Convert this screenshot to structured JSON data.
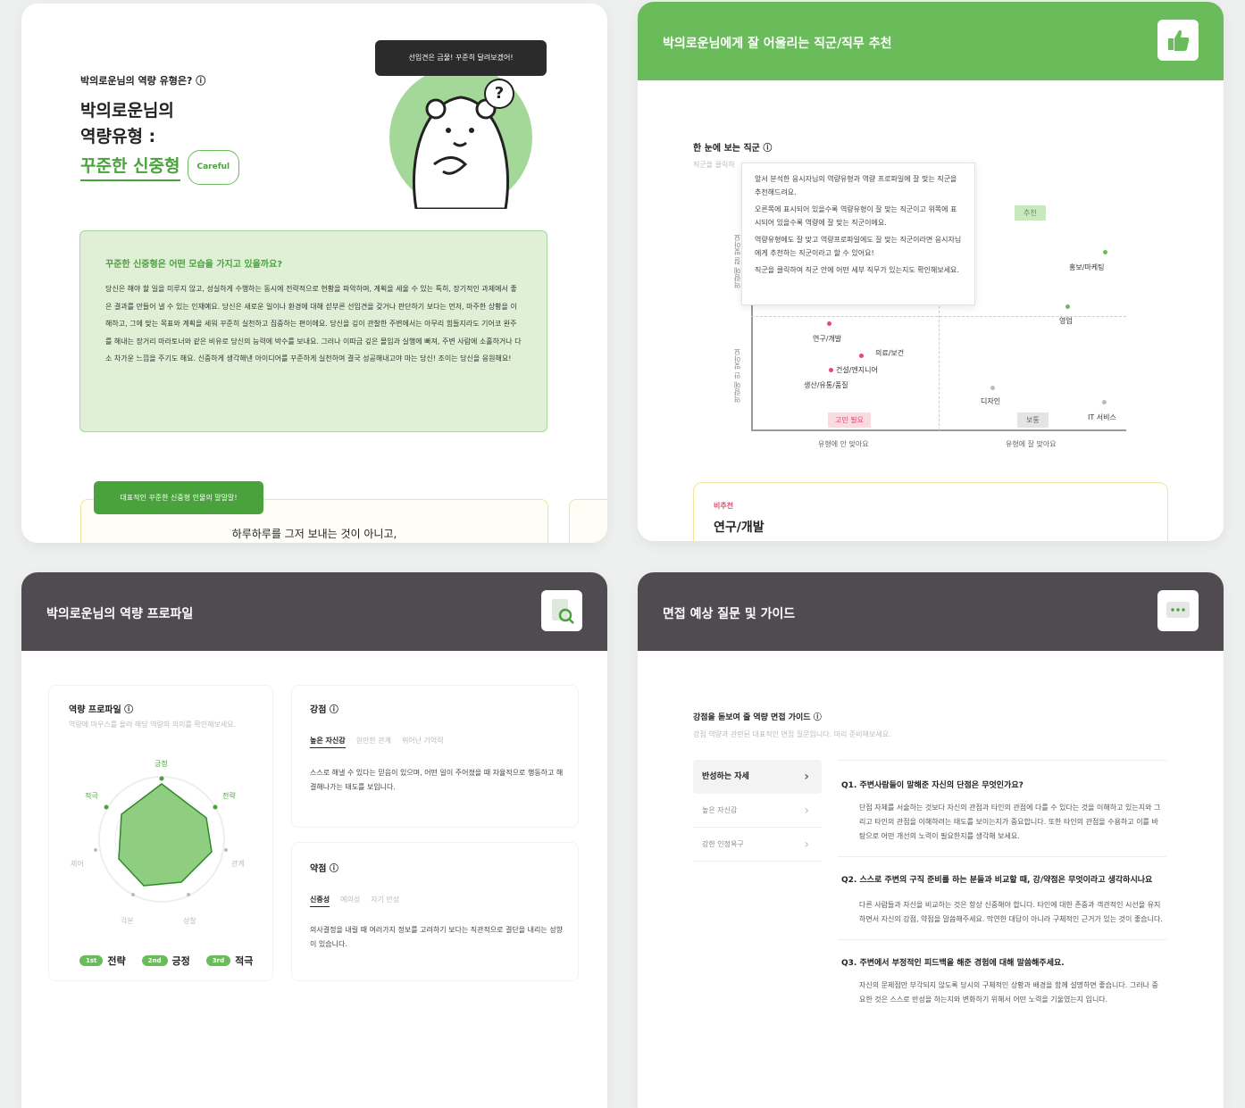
{
  "colors": {
    "accent": "#6abb5a",
    "dark_header": "#4f4b50",
    "red_dot": "#e8476a"
  },
  "p1": {
    "question": "박의로운님의 역량 유형은? ⓘ",
    "title_line1": "박의로운님의",
    "title_line2": "역량유형 :",
    "type_name": "꾸준한 신중형",
    "type_pill": "Careful",
    "speech": "선입견은 금물! 꾸준히 달려보겠어!",
    "box_title": "꾸준한 신중형은 어떤 모습을 가지고 있을까요?",
    "box_body": "당신은 해야 할 일을 미루지 않고, 성실하게 수행하는 동시에 전략적으로 현황을 파악하며, 계획을 세울 수 있는 특히, 장기적인 과제에서 좋은 결과를 만들어 낼 수 있는 인재예요. 당신은 새로운 일이나 환경에 대해 섣부른 선입견을 갖거나 판단하기 보다는 먼저, 마주한 상황을 이해하고, 그에 맞는 목표와 계획을 세워 꾸준히 실천하고 집중하는 편이에요. 당신을 깊이 관찰한 주변에서는 아무리 힘들지라도 기어코 완주를 해내는 장거리 마라토너와 같은 비유로 당신의 능력에 박수를 보내요. 그러나 이따금 깊은 몰입과 실행에 빠져, 주변 사람에 소홀하거나 다소 차가운 느낌을 주기도 해요. 신중하게 생각해낸 아이디어를 꾸준하게 실천하여 결국 성공해내고야 마는 당신! 조이는 당신을 응원해요!",
    "quote_tag": "대표적인 꾸준한 신중형 인물의 말말말!",
    "quote_text": "하루하루를 그저 보내는 것이 아니고,"
  },
  "p2": {
    "header_title": "박의로운님에게 잘 어울리는 직군/직무 추천",
    "section_title": "한 눈에 보는 직군 ⓘ",
    "section_sub": "직군을 클릭하",
    "tooltip": [
      "앞서 분석한 응시자님의 역량유형과 역량 프로파일에 잘 맞는 직군을 추천해드려요.",
      "오른쪽에 표시되어 있을수록 역량유형이 잘 맞는 직군이고 위쪽에 표시되어 있을수록 역량에 잘 맞는 직군이에요.",
      "역량유형에도 잘 맞고 역량프로파일에도 잘 맞는 직군이라면 응시자님에게 추천하는 직군이라고 할 수 있어요!",
      "직군을 클릭하여 직군 안에 어떤 세부 직무가 있는지도 확인해보세요."
    ],
    "chart": {
      "recommend_tag": "추천",
      "caution_tag": "고민 필요",
      "normal_tag": "보통",
      "y_axis_top": "역량에 잘 맞아요",
      "y_axis_bottom": "역량에 안 맞아요",
      "x_left": "유형에 안 맞아요",
      "x_right": "유형에 잘 맞아요",
      "jobs": [
        "홍보/마케팅",
        "영업",
        "연구/개발",
        "의료/보건",
        "건설/엔지니어",
        "생산/유통/품질",
        "디자인",
        "IT 서비스"
      ]
    },
    "card_label": "비추천",
    "card_title": "연구/개발"
  },
  "p3": {
    "header_title": "박의로운님의 역량 프로파일",
    "profile_title": "역량 프로파일 ⓘ",
    "profile_sub": "역량에 마우스를 올려 해당 역량의 의미를 확인해보세요.",
    "radar_labels": [
      "긍정",
      "전략",
      "관계",
      "성찰",
      "각본",
      "제어",
      "적극"
    ],
    "ranks": [
      {
        "badge": "1st",
        "label": "전략"
      },
      {
        "badge": "2nd",
        "label": "긍정"
      },
      {
        "badge": "3rd",
        "label": "적극"
      }
    ],
    "strength_title": "강점 ⓘ",
    "strength_tabs": [
      "높은 자신감",
      "원만한 관계",
      "뛰어난 기억력"
    ],
    "strength_desc": "스스로 해낼 수 있다는 믿음이 있으며, 어떤 일이 주어졌을 때 자율적으로 행동하고 해결해나가는 태도를 보입니다.",
    "weakness_title": "약점 ⓘ",
    "weakness_tabs": [
      "신중성",
      "예의성",
      "자기 반성"
    ],
    "weakness_desc": "의사결정을 내릴 때 여러가지 정보를 고려하기 보다는 직관적으로 결단을 내리는 성향이 있습니다."
  },
  "p4": {
    "header_title": "면접 예상 질문 및 가이드",
    "guide_title": "강점을 돋보여 줄 역량 면접 가이드 ⓘ",
    "guide_sub": "강점 역량과 관련된 대표적인 면접 질문입니다. 미리 준비해보세요.",
    "menu": [
      "반성하는 자세",
      "높은 자신감",
      "강한 인정욕구"
    ],
    "questions": [
      {
        "q": "Q1. 주변사람들이 말해준 자신의 단점은 무엇인가요?",
        "a": "단점 자체를 서술하는 것보다 자신의 관점과 타인의 관점에 다를 수 있다는 것을 이해하고 있는지와 그리고 타인의 관점을 이해하려는 태도를 보이는지가 중요합니다. 또한 타인의 관점을 수용하고 이를 바탕으로 어떤 개선의 노력이 필요한지를 생각해 보세요."
      },
      {
        "q": "Q2. 스스로 주변의 구직 준비를 하는 분들과 비교할 때, 강/약점은 무엇이라고 생각하시나요",
        "a": "다른 사람들과 자신을 비교하는 것은 항상 신중해야 합니다. 타인에 대한 존중과 객관적인 시선을 유지하면서 자신의 강점, 약점을 말씀해주세요. 막연한 대답이 아니라 구체적인 근거가 있는 것이 좋습니다."
      },
      {
        "q": "Q3. 주변에서 부정적인 피드백을 해준 경험에 대해 말씀해주세요.",
        "a": "자신의 문제점만 부각되지 않도록 당시의 구체적인 상황과 배경을 함께 설명하면 좋습니다. 그러나 중요한 것은 스스로 반성을 하는지와 변화하기 위해서 어떤 노력을 기울였는지 입니다."
      }
    ]
  }
}
